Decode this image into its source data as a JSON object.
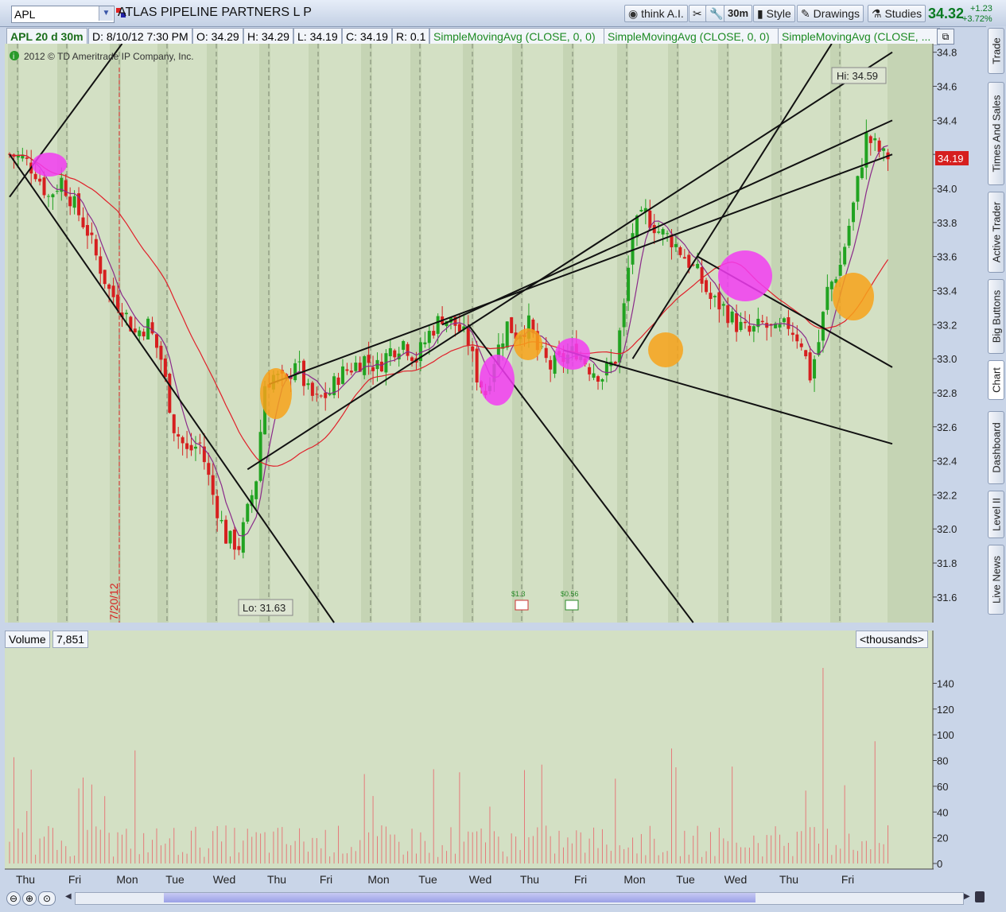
{
  "header": {
    "symbol": "APL",
    "company": "ATLAS PIPELINE PARTNERS L P",
    "last_price": "34.32",
    "change": "+1.23",
    "change_pct": "+3.72%",
    "buttons": [
      "think A.I.",
      "30m",
      "Style",
      "Drawings",
      "Studies"
    ]
  },
  "infobar": {
    "desc": "APL 20 d 30m",
    "date": "D: 8/10/12 7:30 PM",
    "open": "O: 34.29",
    "high": "H: 34.29",
    "low": "L: 34.19",
    "close": "C: 34.19",
    "range": "R: 0.1",
    "studies": [
      "SimpleMovingAvg (CLOSE, 0, 0)",
      "SimpleMovingAvg (CLOSE, 0, 0)",
      "SimpleMovingAvg (CLOSE, ..."
    ]
  },
  "side_tabs": [
    "Trade",
    "Times And Sales",
    "Active Trader",
    "Big Buttons",
    "Chart",
    "Dashboard",
    "Level II",
    "Live News"
  ],
  "chart_data": {
    "type": "candlestick",
    "copyright": "2012 © TD Ameritrade IP Company, Inc.",
    "y_ticks": [
      34.8,
      34.6,
      34.4,
      34.2,
      34.0,
      33.8,
      33.6,
      33.4,
      33.2,
      33.0,
      32.8,
      32.6,
      32.4,
      32.2,
      32.0,
      31.8,
      31.6
    ],
    "ylim": [
      31.45,
      34.85
    ],
    "x_labels": [
      "Thu",
      "Fri",
      "Mon",
      "Tue",
      "Wed",
      "Thu",
      "Fri",
      "Mon",
      "Tue",
      "Wed",
      "Thu",
      "Fri",
      "Mon",
      "Tue",
      "Wed",
      "Thu",
      "Fri"
    ],
    "last_price_marker": "34.19",
    "hi_label": "Hi: 34.59",
    "lo_label": "Lo: 31.63",
    "date_marker": "7/20/12",
    "dividends": [
      "$1.3",
      "$0.56"
    ],
    "close_path": [
      [
        0,
        34.2
      ],
      [
        3,
        34.18
      ],
      [
        6,
        34.1
      ],
      [
        9,
        33.95
      ],
      [
        12,
        34.05
      ],
      [
        15,
        33.9
      ],
      [
        18,
        33.75
      ],
      [
        20,
        33.6
      ],
      [
        23,
        33.4
      ],
      [
        26,
        33.3
      ],
      [
        29,
        33.15
      ],
      [
        32,
        33.2
      ],
      [
        35,
        33.0
      ],
      [
        38,
        32.6
      ],
      [
        41,
        32.45
      ],
      [
        44,
        32.5
      ],
      [
        47,
        32.2
      ],
      [
        50,
        31.95
      ],
      [
        53,
        31.9
      ],
      [
        55,
        32.1
      ],
      [
        57,
        32.3
      ],
      [
        59,
        32.85
      ],
      [
        61,
        32.9
      ],
      [
        64,
        32.85
      ],
      [
        66,
        33.0
      ],
      [
        69,
        32.8
      ],
      [
        71,
        32.75
      ],
      [
        74,
        32.8
      ],
      [
        76,
        32.9
      ],
      [
        79,
        32.95
      ],
      [
        82,
        33.0
      ],
      [
        85,
        32.95
      ],
      [
        88,
        33.05
      ],
      [
        91,
        33.1
      ],
      [
        94,
        33.0
      ],
      [
        97,
        33.15
      ],
      [
        100,
        33.25
      ],
      [
        103,
        33.2
      ],
      [
        106,
        33.1
      ],
      [
        108,
        32.9
      ],
      [
        110,
        32.8
      ],
      [
        112,
        33.0
      ],
      [
        115,
        33.2
      ],
      [
        117,
        33.15
      ],
      [
        120,
        33.2
      ],
      [
        122,
        33.05
      ],
      [
        125,
        32.95
      ],
      [
        128,
        33.0
      ],
      [
        131,
        33.05
      ],
      [
        134,
        32.95
      ],
      [
        137,
        32.9
      ],
      [
        140,
        33.0
      ],
      [
        142,
        33.3
      ],
      [
        144,
        33.75
      ],
      [
        147,
        33.85
      ],
      [
        150,
        33.75
      ],
      [
        153,
        33.7
      ],
      [
        156,
        33.6
      ],
      [
        159,
        33.5
      ],
      [
        162,
        33.35
      ],
      [
        165,
        33.3
      ],
      [
        168,
        33.2
      ],
      [
        171,
        33.15
      ],
      [
        174,
        33.2
      ],
      [
        177,
        33.15
      ],
      [
        180,
        33.2
      ],
      [
        183,
        33.1
      ],
      [
        185,
        32.9
      ],
      [
        187,
        33.1
      ],
      [
        189,
        33.4
      ],
      [
        192,
        33.55
      ],
      [
        195,
        33.9
      ],
      [
        198,
        34.3
      ],
      [
        200,
        34.25
      ],
      [
        202,
        34.19
      ]
    ],
    "sma_fast_color": "#8a2a8a",
    "sma_slow_color": "#e0202a",
    "trendlines": 9,
    "volume": {
      "label": "Volume",
      "value": "7,851",
      "units": "<thousands>",
      "y_ticks": [
        140,
        120,
        100,
        80,
        60,
        40,
        20,
        0
      ],
      "ylim": [
        0,
        160
      ]
    },
    "colors": {
      "up": "#21a321",
      "down": "#d61f1f",
      "bg": "#d3e0c4",
      "band": "#c5d4b4"
    }
  }
}
